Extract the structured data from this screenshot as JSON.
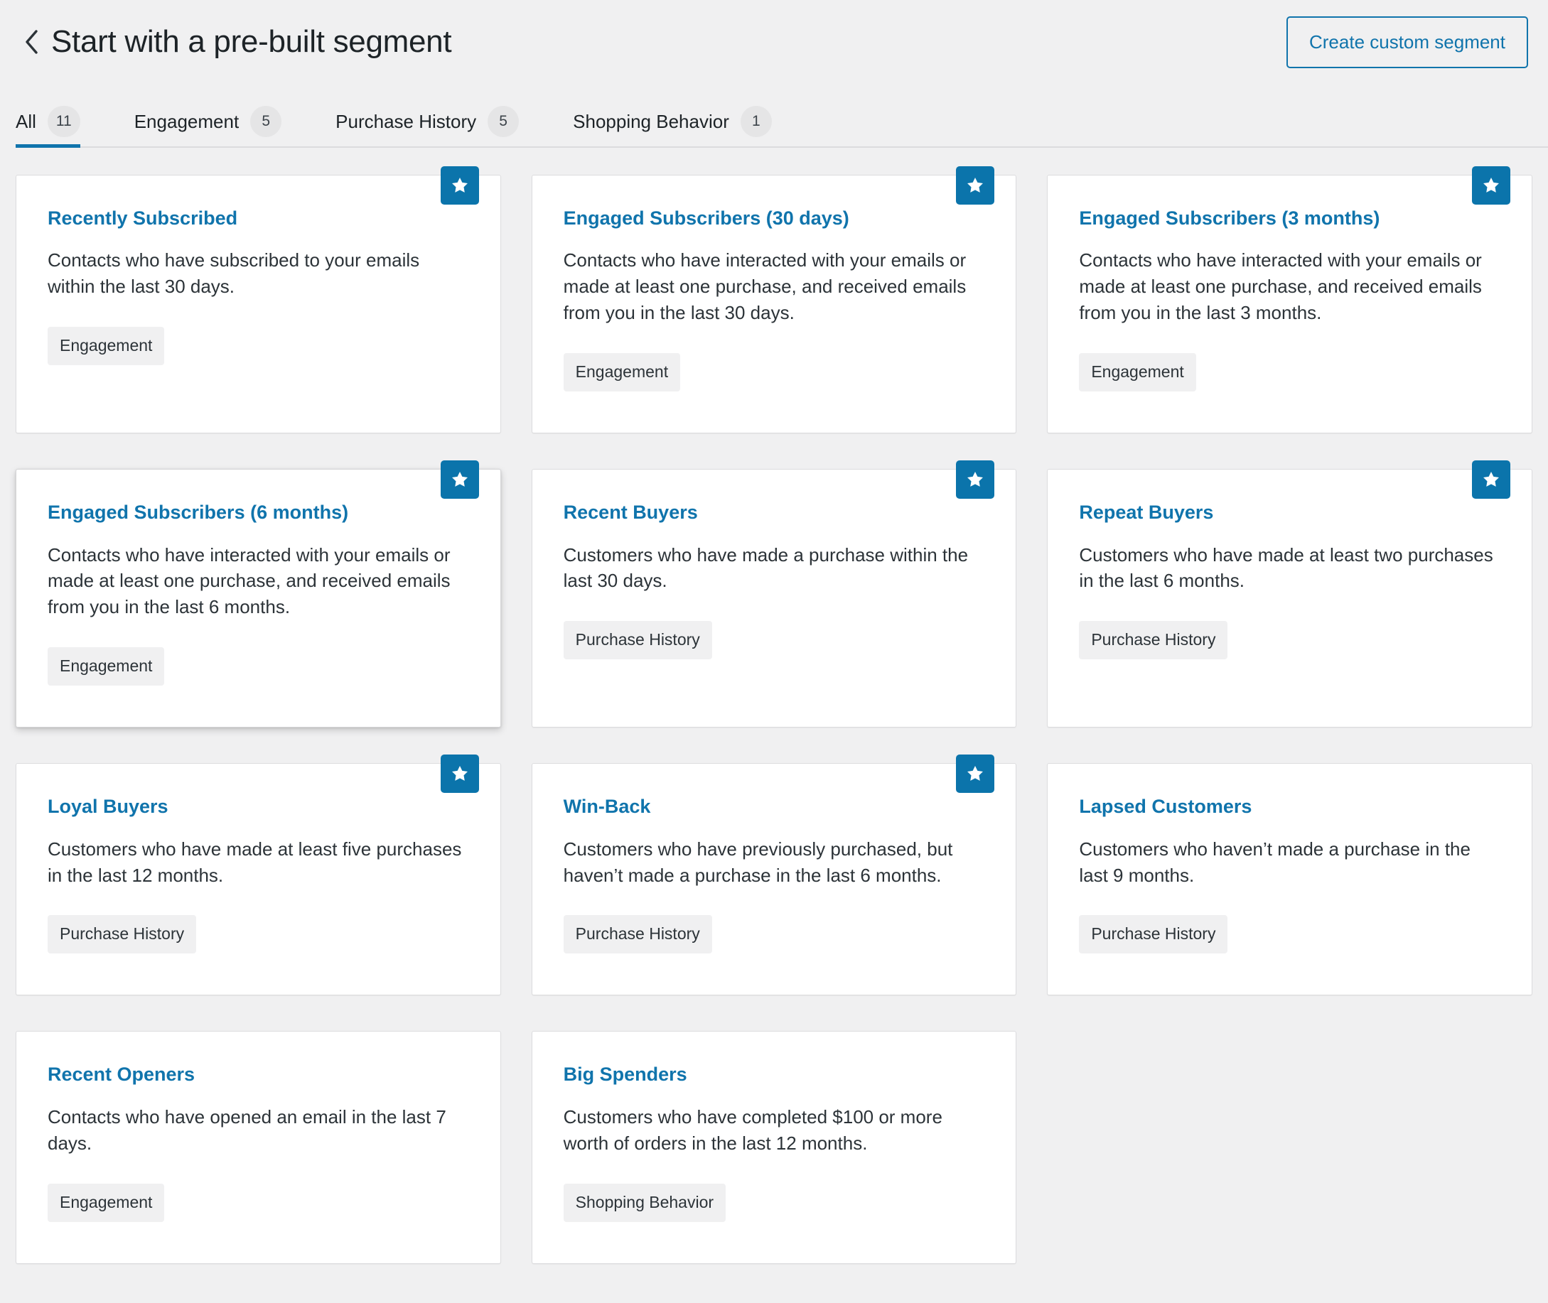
{
  "header": {
    "back_icon": "chevron-left-icon",
    "title": "Start with a pre-built segment",
    "create_button_label": "Create custom segment"
  },
  "tabs": [
    {
      "label": "All",
      "count": "11",
      "active": true
    },
    {
      "label": "Engagement",
      "count": "5",
      "active": false
    },
    {
      "label": "Purchase History",
      "count": "5",
      "active": false
    },
    {
      "label": "Shopping Behavior",
      "count": "1",
      "active": false
    }
  ],
  "colors": {
    "accent": "#1074ac",
    "badge": "#0b74ab",
    "page_background": "#f0f0f1",
    "card_background": "#ffffff",
    "card_border": "#dcdcde",
    "tag_background": "#f0f0f1",
    "text": "#2c3338"
  },
  "cards": [
    {
      "title": "Recently Subscribed",
      "description": "Contacts who have subscribed to your emails within the last 30 days.",
      "tag": "Engagement",
      "starred": true,
      "elevated": false
    },
    {
      "title": "Engaged Subscribers (30 days)",
      "description": "Contacts who have interacted with your emails or made at least one purchase, and received emails from you in the last 30 days.",
      "tag": "Engagement",
      "starred": true,
      "elevated": false
    },
    {
      "title": "Engaged Subscribers (3 months)",
      "description": "Contacts who have interacted with your emails or made at least one purchase, and received emails from you in the last 3 months.",
      "tag": "Engagement",
      "starred": true,
      "elevated": false
    },
    {
      "title": "Engaged Subscribers (6 months)",
      "description": "Contacts who have interacted with your emails or made at least one purchase, and received emails from you in the last 6 months.",
      "tag": "Engagement",
      "starred": true,
      "elevated": true
    },
    {
      "title": "Recent Buyers",
      "description": "Customers who have made a purchase within the last 30 days.",
      "tag": "Purchase History",
      "starred": true,
      "elevated": false
    },
    {
      "title": "Repeat Buyers",
      "description": "Customers who have made at least two purchases in the last 6 months.",
      "tag": "Purchase History",
      "starred": true,
      "elevated": false
    },
    {
      "title": "Loyal Buyers",
      "description": "Customers who have made at least five purchases in the last 12 months.",
      "tag": "Purchase History",
      "starred": true,
      "elevated": false
    },
    {
      "title": "Win-Back",
      "description": "Customers who have previously purchased, but haven’t made a purchase in the last 6 months.",
      "tag": "Purchase History",
      "starred": true,
      "elevated": false
    },
    {
      "title": "Lapsed Customers",
      "description": "Customers who haven’t made a purchase in the last 9 months.",
      "tag": "Purchase History",
      "starred": false,
      "elevated": false
    },
    {
      "title": "Recent Openers",
      "description": "Contacts who have opened an email in the last 7 days.",
      "tag": "Engagement",
      "starred": false,
      "elevated": false
    },
    {
      "title": "Big Spenders",
      "description": "Customers who have completed $100 or more worth of orders in the last 12 months.",
      "tag": "Shopping Behavior",
      "starred": false,
      "elevated": false
    }
  ]
}
